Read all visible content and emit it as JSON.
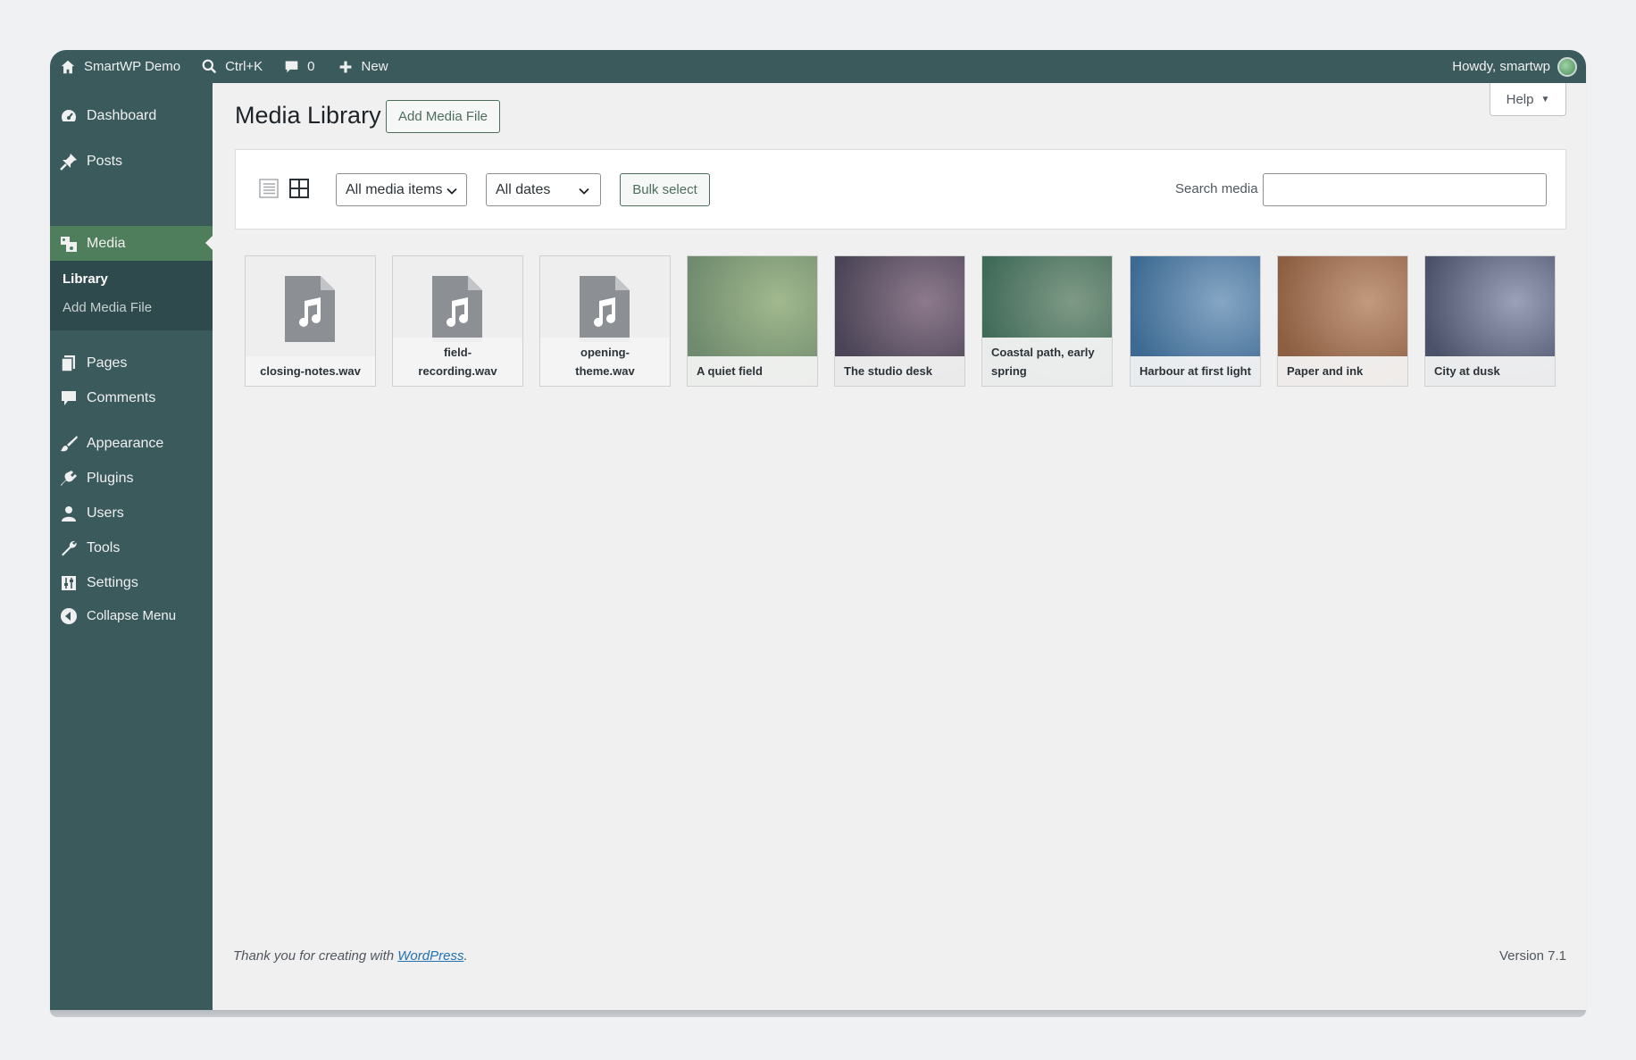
{
  "adminbar": {
    "site_name": "SmartWP Demo",
    "search_shortcut": "Ctrl+K",
    "comments_count": "0",
    "new_label": "New",
    "howdy": "Howdy, smartwp"
  },
  "sidebar": {
    "items": [
      {
        "label": "Dashboard",
        "icon": "dashboard-icon"
      },
      {
        "label": "Posts",
        "icon": "pin-icon"
      },
      {
        "label": "Media",
        "icon": "media-icon"
      },
      {
        "label": "Pages",
        "icon": "pages-icon"
      },
      {
        "label": "Comments",
        "icon": "comment-icon"
      },
      {
        "label": "Appearance",
        "icon": "brush-icon"
      },
      {
        "label": "Plugins",
        "icon": "plugin-icon"
      },
      {
        "label": "Users",
        "icon": "user-icon"
      },
      {
        "label": "Tools",
        "icon": "wrench-icon"
      },
      {
        "label": "Settings",
        "icon": "settings-icon"
      },
      {
        "label": "Collapse Menu",
        "icon": "collapse-icon"
      }
    ],
    "submenu": [
      "Library",
      "Add Media File"
    ]
  },
  "page": {
    "title": "Media Library",
    "add_button": "Add Media File",
    "help": "Help"
  },
  "toolbar": {
    "filter_type": "All media items",
    "filter_date": "All dates",
    "bulk_select": "Bulk select",
    "search_label": "Search media",
    "search_value": ""
  },
  "media": [
    {
      "caption": "closing-notes.wav",
      "type": "audio"
    },
    {
      "caption": "field-\nrecording.wav",
      "type": "audio"
    },
    {
      "caption": "opening-\ntheme.wav",
      "type": "audio"
    },
    {
      "caption": "A quiet field",
      "type": "image",
      "colors": [
        "#6f8a6e",
        "#a2b98e"
      ]
    },
    {
      "caption": "The studio desk",
      "type": "image",
      "colors": [
        "#4a4456",
        "#8d7a8c"
      ]
    },
    {
      "caption": "Coastal path, early spring",
      "type": "image",
      "colors": [
        "#3f6a58",
        "#7f9a86"
      ]
    },
    {
      "caption": "Harbour at first light",
      "type": "image",
      "colors": [
        "#3d6a92",
        "#86a6c4"
      ]
    },
    {
      "caption": "Paper and ink",
      "type": "image",
      "colors": [
        "#8c5e42",
        "#c39a7e"
      ]
    },
    {
      "caption": "City at dusk",
      "type": "image",
      "colors": [
        "#4a5168",
        "#9aa1b8"
      ]
    }
  ],
  "footer": {
    "thanks_prefix": "Thank you for creating with ",
    "thanks_link": "WordPress",
    "thanks_suffix": ".",
    "version": "Version 7.1"
  }
}
